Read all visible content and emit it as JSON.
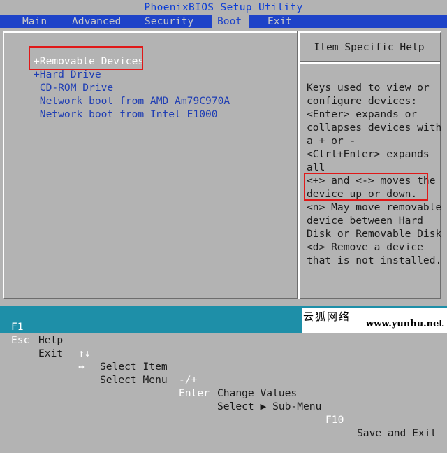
{
  "window": {
    "title": "PhoenixBIOS Setup Utility"
  },
  "menu": {
    "tabs": [
      {
        "label": "Main"
      },
      {
        "label": "Advanced"
      },
      {
        "label": "Security"
      },
      {
        "label": "Boot"
      },
      {
        "label": "Exit"
      }
    ],
    "active": "Boot"
  },
  "boot": {
    "items": [
      {
        "label": "+Removable Devices",
        "selected": true
      },
      {
        "label": "+Hard Drive",
        "selected": false
      },
      {
        "label": " CD-ROM Drive",
        "selected": false
      },
      {
        "label": " Network boot from AMD Am79C970A",
        "selected": false
      },
      {
        "label": " Network boot from Intel E1000",
        "selected": false
      }
    ]
  },
  "help": {
    "title": "Item Specific Help",
    "lines": [
      "Keys used to view or",
      "configure devices:",
      "<Enter> expands or",
      "collapses devices with",
      "a + or -",
      "<Ctrl+Enter> expands",
      "all",
      "<+> and <-> moves the",
      "device up or down.",
      "<n> May move removable",
      "device between Hard",
      "Disk or Removable Disk",
      "<d> Remove a device",
      "that is not installed."
    ]
  },
  "footer": {
    "row1": [
      {
        "key": "F1",
        "desc": "Help"
      },
      {
        "key": "↑↓",
        "desc": "Select Item"
      },
      {
        "key": "-/+",
        "desc": "Change Values"
      }
    ],
    "row2": [
      {
        "key": "Esc",
        "desc": "Exit"
      },
      {
        "key": "↔",
        "desc": "Select Menu"
      },
      {
        "key": "Enter",
        "desc": "Select ▶ Sub-Menu"
      },
      {
        "key": "F10",
        "desc": "Save and Exit"
      }
    ]
  },
  "watermark": {
    "cn": "云狐网络",
    "en": "www.yunhu.net"
  },
  "colors": {
    "background": "#b3b3b3",
    "menu_bar": "#1e43c8",
    "footer": "#1e8fa8",
    "highlight_box": "#e01818"
  }
}
